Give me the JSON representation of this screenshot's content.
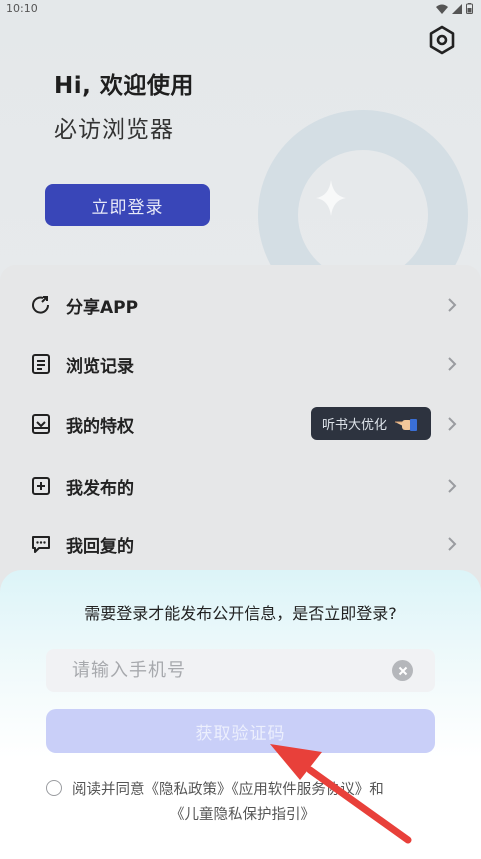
{
  "status_bar": {
    "time": "10:10"
  },
  "header": {
    "greeting_title": "Hi, 欢迎使用",
    "greeting_subtitle": "必访浏览器",
    "login_button": "立即登录"
  },
  "menu": {
    "items": [
      {
        "label": "分享APP",
        "icon": "share-icon"
      },
      {
        "label": "浏览记录",
        "icon": "history-icon"
      },
      {
        "label": "我的特权",
        "icon": "privilege-icon"
      },
      {
        "label": "我发布的",
        "icon": "add-post-icon"
      },
      {
        "label": "我回复的",
        "icon": "reply-icon"
      }
    ],
    "promo_tag": "听书大优化"
  },
  "login_sheet": {
    "prompt": "需要登录才能发布公开信息，是否立即登录?",
    "phone_placeholder": "请输入手机号",
    "get_code_button": "获取验证码",
    "agreement_line1": "阅读并同意《隐私政策》《应用软件服务协议》和",
    "agreement_line2": "《儿童隐私保护指引》"
  },
  "colors": {
    "primary": "#3946b8",
    "code_button": "#c9cff8",
    "promo_bg": "#2d333f",
    "annotation_arrow": "#e8403a"
  }
}
